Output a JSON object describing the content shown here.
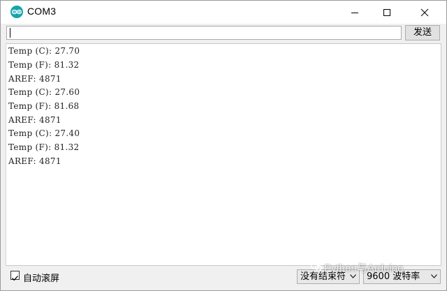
{
  "window": {
    "title": "COM3"
  },
  "send": {
    "input_value": "",
    "button_label": "发送"
  },
  "output": {
    "lines": [
      "Temp (C): 27.70",
      "Temp (F): 81.32",
      "AREF: 4871",
      "Temp (C): 27.60",
      "Temp (F): 81.68",
      "AREF: 4871",
      "Temp (C): 27.40",
      "Temp (F): 81.32",
      "AREF: 4871"
    ]
  },
  "footer": {
    "autoscroll_label": "自动滚屏",
    "autoscroll_checked": true,
    "line_ending": "没有结束符",
    "baud_rate": "9600 波特率"
  },
  "watermark": {
    "text": "Python与Arduino"
  },
  "colors": {
    "accent": "#15a4ad",
    "chrome": "#f0f0f0"
  }
}
